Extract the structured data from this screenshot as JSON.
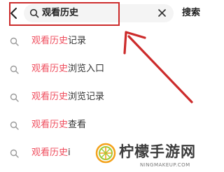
{
  "search": {
    "query": "观看历史",
    "button_label": "搜索"
  },
  "suggestions": [
    {
      "keyword": "观看历史",
      "rest": "记录"
    },
    {
      "keyword": "观看历史",
      "rest": "浏览入口"
    },
    {
      "keyword": "观看历史",
      "rest": "浏览记录"
    },
    {
      "keyword": "观看历史",
      "rest": "查看"
    },
    {
      "keyword": "观看历史",
      "rest": "i"
    }
  ],
  "colors": {
    "keyword": "#ef4d5d",
    "annotation": "#cc2b2b"
  },
  "icons": {
    "back": "chevron-left-icon",
    "search": "search-icon",
    "clear": "close-icon"
  },
  "watermark": {
    "name": "柠檬手游网",
    "url": "NINGMAKEUP.COM"
  }
}
